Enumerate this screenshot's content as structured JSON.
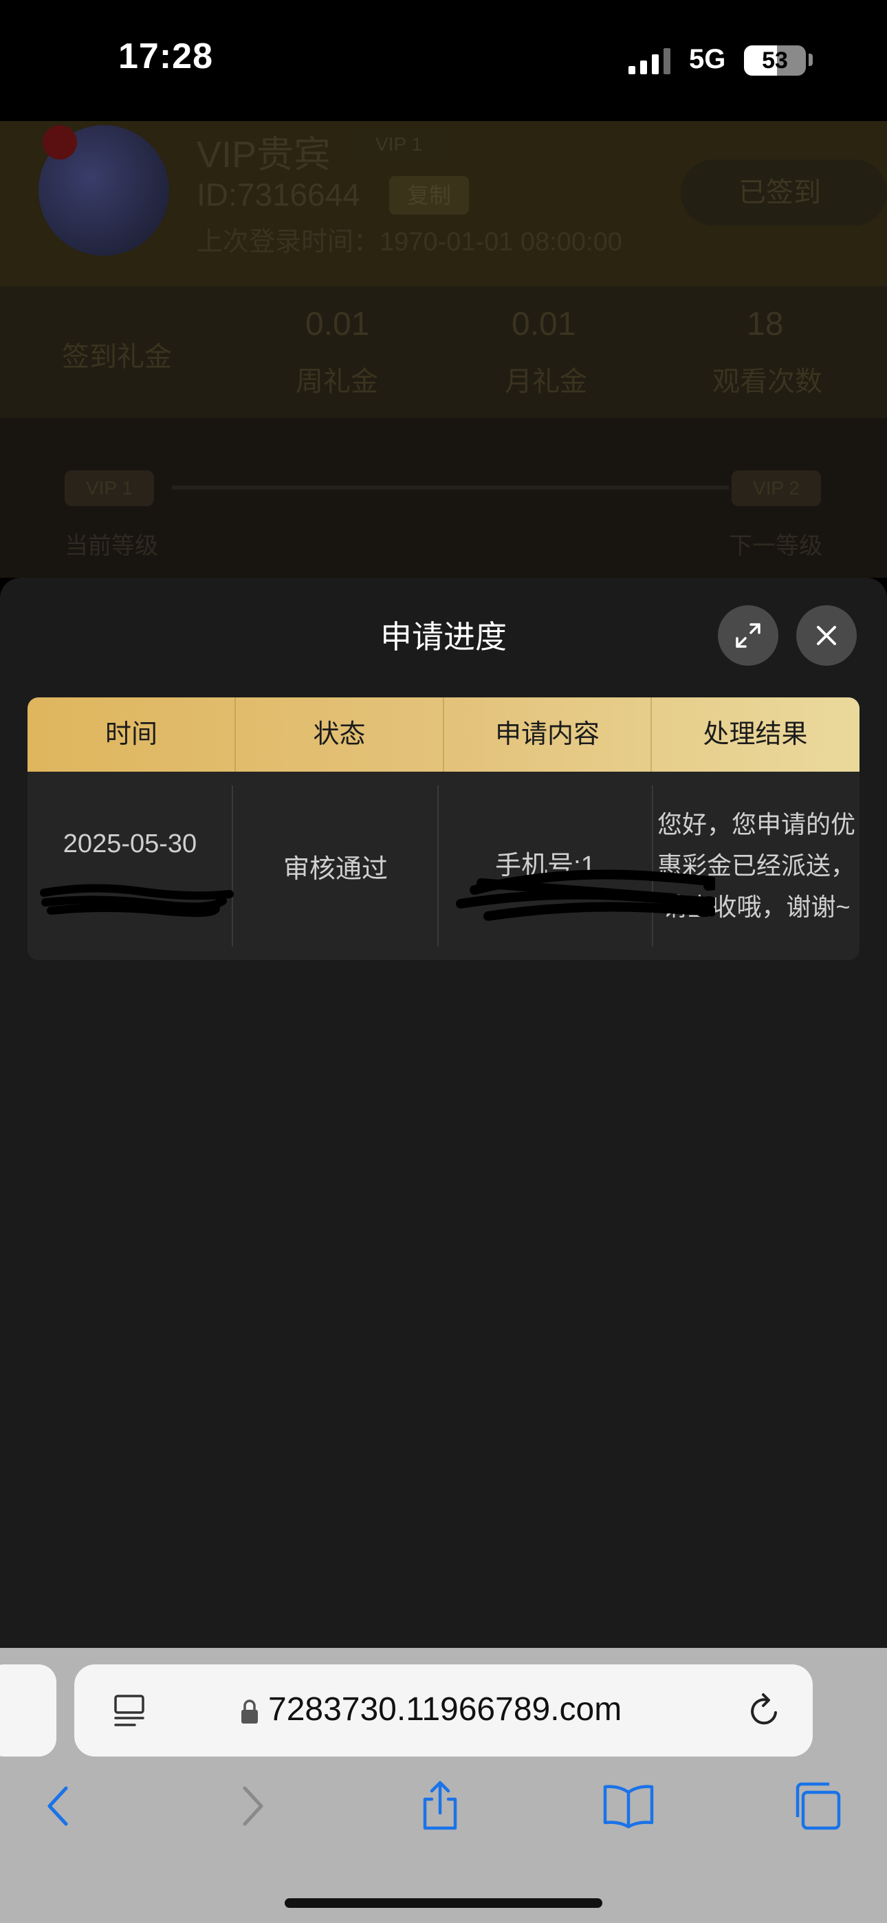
{
  "status_bar": {
    "time": "17:28",
    "network": "5G",
    "battery": "53"
  },
  "background_page": {
    "vip_title": "VIP贵宾",
    "vip_badge": "VIP 1",
    "user_id": "ID:7316644",
    "copy_label": "复制",
    "last_login": "上次登录时间：1970-01-01 08:00:00",
    "signed_in_label": "已签到",
    "signin_bonus_label": "签到礼金",
    "stats": [
      {
        "value": "0.01",
        "label": "周礼金"
      },
      {
        "value": "0.01",
        "label": "月礼金"
      },
      {
        "value": "18",
        "label": "观看次数"
      }
    ],
    "level_current": "VIP 1",
    "level_next": "VIP 2",
    "level_text_left": "当前等级",
    "level_text_right": "下一等级"
  },
  "sheet": {
    "title": "申请进度",
    "table": {
      "headers": [
        "时间",
        "状态",
        "申请内容",
        "处理结果"
      ],
      "rows": [
        {
          "time": "2025-05-30",
          "status": "审核通过",
          "content": "手机号:1",
          "result": "您好，您申请的优惠彩金已经派送，请查收哦，谢谢~"
        }
      ]
    }
  },
  "browser": {
    "url": "7283730.11966789.com"
  }
}
